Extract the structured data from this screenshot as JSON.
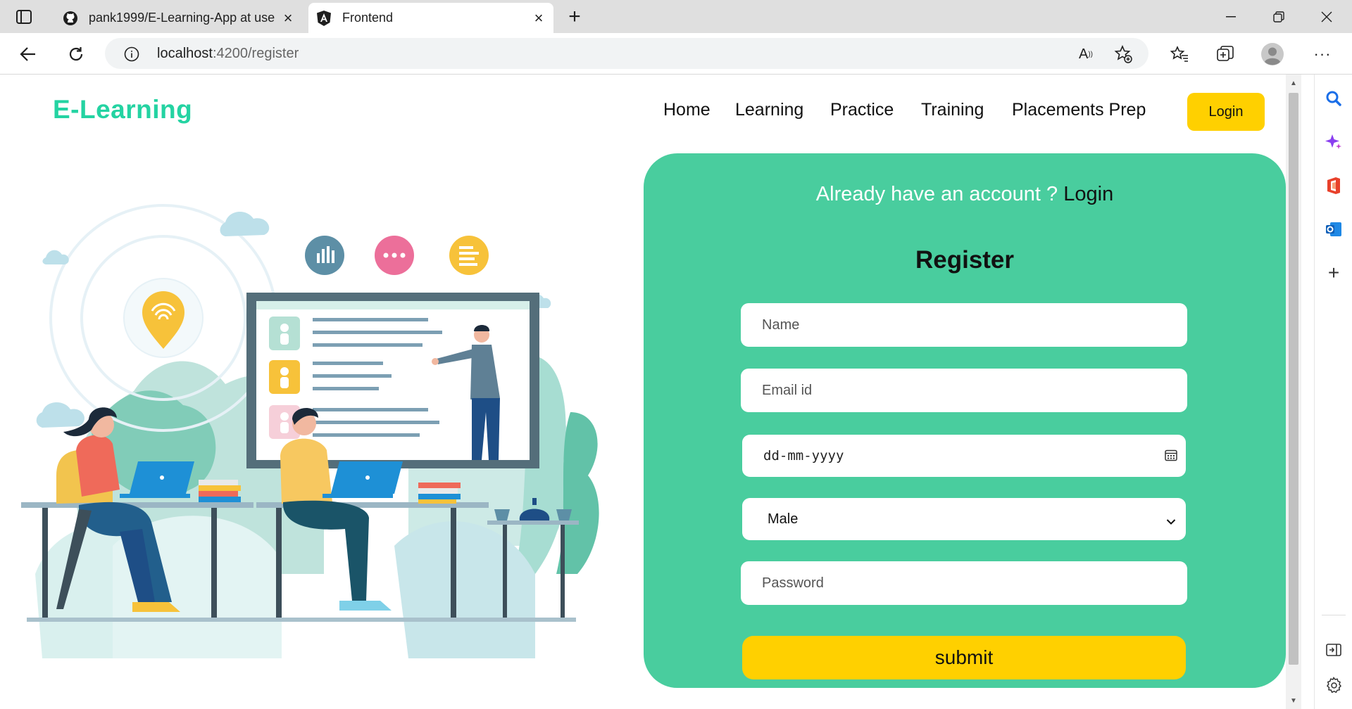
{
  "browser": {
    "tabs": [
      {
        "title": "pank1999/E-Learning-App at use",
        "icon": "github-icon"
      },
      {
        "title": "Frontend",
        "icon": "angular-icon"
      }
    ],
    "url_host": "localhost",
    "url_rest": ":4200/register"
  },
  "header": {
    "logo": "E-Learning",
    "nav": [
      "Home",
      "Learning",
      "Practice",
      "Training",
      "Placements Prep"
    ],
    "login_button": "Login"
  },
  "form": {
    "already_text": "Already have an account ?",
    "already_link": "Login",
    "title": "Register",
    "name_placeholder": "Name",
    "email_placeholder": "Email id",
    "date_placeholder": "dd-mm-yyyy",
    "gender_value": "Male",
    "password_placeholder": "Password",
    "submit_label": "submit"
  },
  "colors": {
    "accent_green": "#49cd9e",
    "logo_green": "#24d3a2",
    "button_yellow": "#ffd000"
  }
}
